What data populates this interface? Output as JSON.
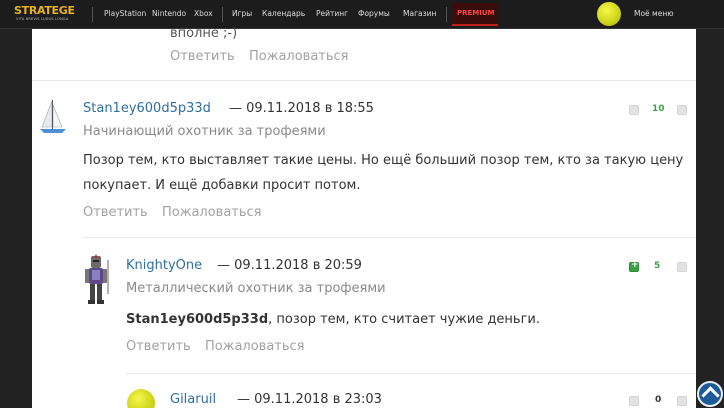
{
  "navbar": {
    "logo_text": "STRATEGE",
    "logo_sub": "VITA BREVIS LUDUS LONGA",
    "items": [
      "PlayStation",
      "Nintendo",
      "Xbox",
      "Игры",
      "Календарь",
      "Рейтинг",
      "Форумы",
      "Магазин"
    ],
    "premium_label": "PREMIUM",
    "my_menu_label": "Моё меню"
  },
  "prev_comment": {
    "text_tail": "вполне ;-)",
    "reply_label": "Ответить",
    "report_label": "Пожаловаться"
  },
  "comments": [
    {
      "author": "Stan1ey600d5p33d",
      "date": "— 09.11.2018 в 18:55",
      "rank": "Начинающий охотник за трофеями",
      "text_line1": "Позор тем, кто выставляет такие цены. Но ещё больший позор тем, кто за такую цену",
      "text_line2": "покупает. И ещё добавки просит потом.",
      "score": "10",
      "score_color": "#3aa245",
      "reply_label": "Ответить",
      "report_label": "Пожаловаться",
      "avatar_icon": "sailboat-icon"
    },
    {
      "author": "KnightyOne",
      "date": "— 09.11.2018 в 20:59",
      "rank": "Металлический охотник за трофеями",
      "mention": "Stan1ey600d5p33d",
      "text_rest": ", позор тем, кто считает чужие деньги.",
      "score": "5",
      "score_color": "#3aa245",
      "reply_label": "Ответить",
      "report_label": "Пожаловаться",
      "avatar_icon": "knight-icon"
    },
    {
      "author": "Gilaruil",
      "date": "— 09.11.2018 в 23:03",
      "score": "0",
      "score_color": "#333333",
      "avatar_icon": "tennis-ball-icon"
    }
  ]
}
